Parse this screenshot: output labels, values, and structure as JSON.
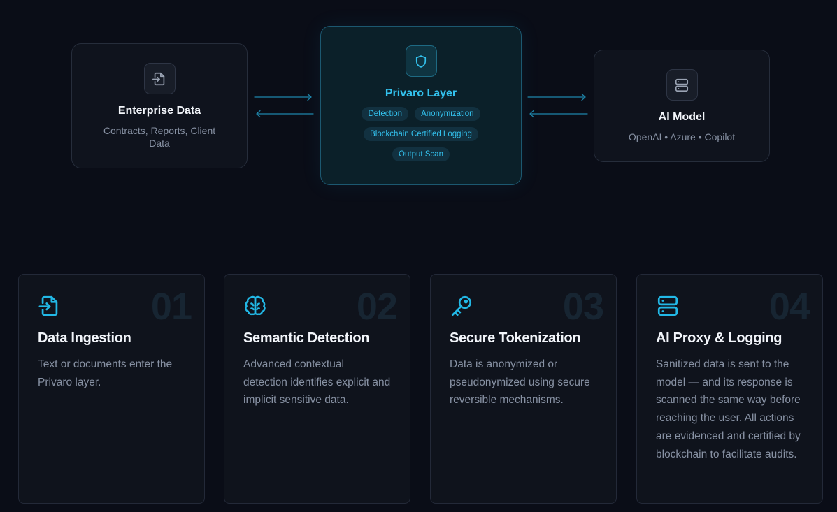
{
  "diagram": {
    "left_node": {
      "title": "Enterprise Data",
      "subtitle": "Contracts, Reports, Client Data",
      "icon": "file-import-icon"
    },
    "center_node": {
      "title": "Privaro Layer",
      "icon": "shield-icon",
      "chips": [
        "Detection",
        "Anonymization",
        "Blockchain Certified Logging",
        "Output Scan"
      ]
    },
    "right_node": {
      "title": "AI Model",
      "subtitle": "OpenAI • Azure • Copilot",
      "icon": "server-icon"
    }
  },
  "steps": [
    {
      "number": "01",
      "icon": "file-import-icon",
      "title": "Data Ingestion",
      "description": "Text or documents enter the Privaro layer."
    },
    {
      "number": "02",
      "icon": "brain-icon",
      "title": "Semantic Detection",
      "description": "Advanced contextual detection identifies explicit and implicit sensitive data."
    },
    {
      "number": "03",
      "icon": "key-icon",
      "title": "Secure Tokenization",
      "description": "Data is anonymized or pseudonymized using secure reversible mechanisms."
    },
    {
      "number": "04",
      "icon": "server-icon",
      "title": "AI Proxy & Logging",
      "description": "Sanitized data is sent to the model — and its response is scanned the same way before reaching the user. All actions are evidenced and certified by blockchain to facilitate audits."
    }
  ],
  "colors": {
    "background": "#0a0d17",
    "accent": "#22b8e6",
    "card_bg": "#0f131c",
    "muted_text": "#8791a3"
  }
}
